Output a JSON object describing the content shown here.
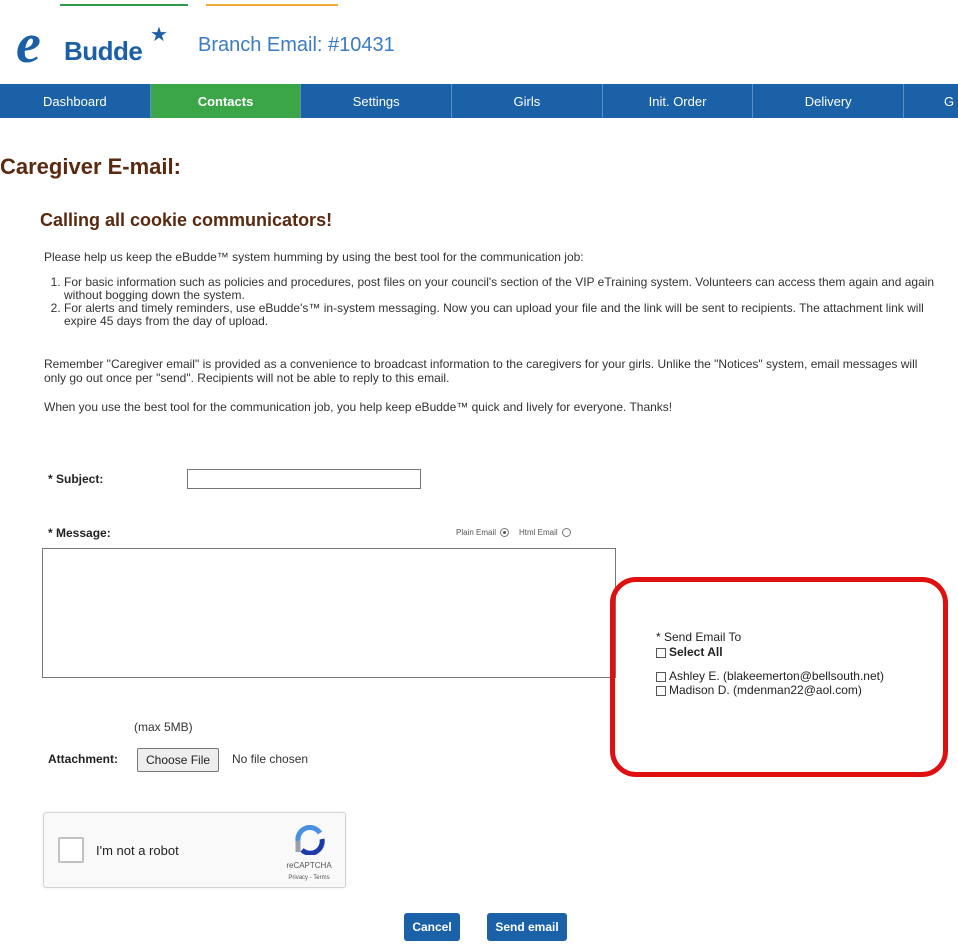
{
  "header": {
    "logo_text": "Budde",
    "branch_label": "Branch Email: #10431"
  },
  "nav": {
    "items": [
      {
        "label": "Dashboard"
      },
      {
        "label": "Contacts"
      },
      {
        "label": "Settings"
      },
      {
        "label": "Girls"
      },
      {
        "label": "Init. Order"
      },
      {
        "label": "Delivery"
      },
      {
        "label": "G"
      }
    ],
    "active": "Contacts"
  },
  "page": {
    "title": "Caregiver E-mail:",
    "heading": "Calling all cookie communicators!",
    "intro": "Please help us keep the eBudde™ system humming by using the best tool for the communication job:",
    "list": [
      "For basic information such as policies and procedures, post files on your council's section of the VIP eTraining system. Volunteers can access them again and again without bogging down the system.",
      "For alerts and timely reminders, use eBudde's™ in-system messaging. Now you can upload your file and the link will be sent to recipients. The attachment link will expire 45 days from the day of upload."
    ],
    "remember": "Remember \"Caregiver email\" is provided as a convenience to broadcast information to the caregivers for your girls. Unlike the \"Notices\" system, email messages will only go out once per \"send\". Recipients will not be able to reply to this email.",
    "closing": "When you use the best tool for the communication job, you help keep eBudde™ quick and lively for everyone. Thanks!"
  },
  "form": {
    "subject_label": "* Subject:",
    "subject_value": "",
    "message_label": "* Message:",
    "plain_email_label": "Plain Email",
    "html_email_label": "Html Email",
    "email_type_selected": "Plain Email",
    "max_size": "(max 5MB)",
    "attachment_label": "Attachment:",
    "choose_file_label": "Choose File",
    "no_file_text": "No file chosen"
  },
  "recipients": {
    "title": "* Send Email To",
    "select_all_label": "Select All",
    "items": [
      {
        "label": "Ashley E. (blakeemerton@bellsouth.net)"
      },
      {
        "label": "Madison D. (mdenman22@aol.com)"
      }
    ]
  },
  "captcha": {
    "label": "I'm not a robot",
    "brand": "reCAPTCHA",
    "links": "Privacy - Terms"
  },
  "buttons": {
    "cancel": "Cancel",
    "send": "Send email"
  },
  "colors": {
    "nav_bg": "#1a61a8",
    "nav_active": "#3aa647",
    "heading": "#5a2a10",
    "highlight_box": "#e01010"
  }
}
